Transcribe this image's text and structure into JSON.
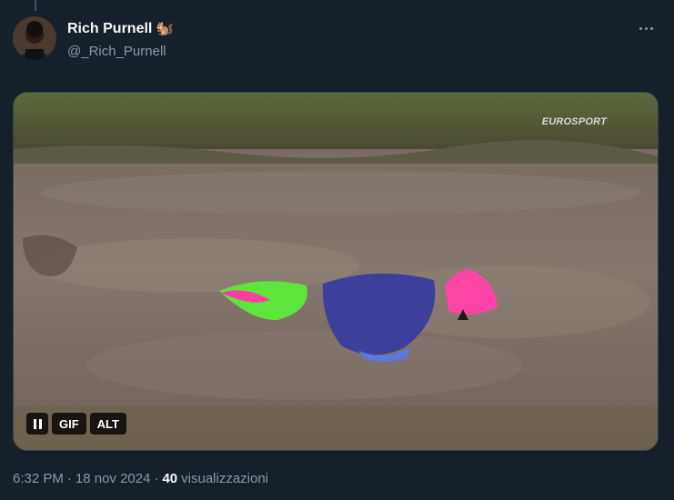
{
  "author": {
    "display_name": "Rich Purnell",
    "name_emoji": "🐿️",
    "handle": "@_Rich_Purnell"
  },
  "media": {
    "watermark": "EUROSPORT",
    "gif_label": "GIF",
    "alt_label": "ALT"
  },
  "meta": {
    "time": "6:32 PM",
    "separator1": "·",
    "date": "18 nov 2024",
    "separator2": "·",
    "views_count": "40",
    "views_label": "visualizzazioni"
  }
}
